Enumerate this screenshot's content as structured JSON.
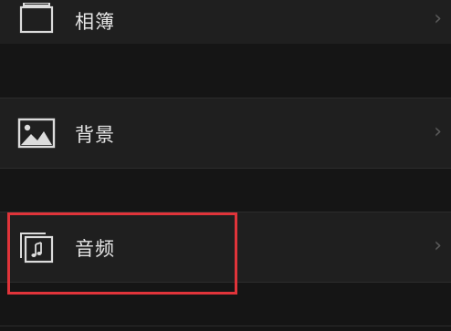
{
  "settings": {
    "items": [
      {
        "label": "相簿",
        "icon": "album-stack-icon"
      },
      {
        "label": "背景",
        "icon": "image-landscape-icon"
      },
      {
        "label": "音频",
        "icon": "music-note-stack-icon"
      }
    ],
    "chevron_glyph": "›"
  },
  "colors": {
    "background": "#1a1a1a",
    "row": "#1f1f1f",
    "highlight": "#e0343a"
  }
}
